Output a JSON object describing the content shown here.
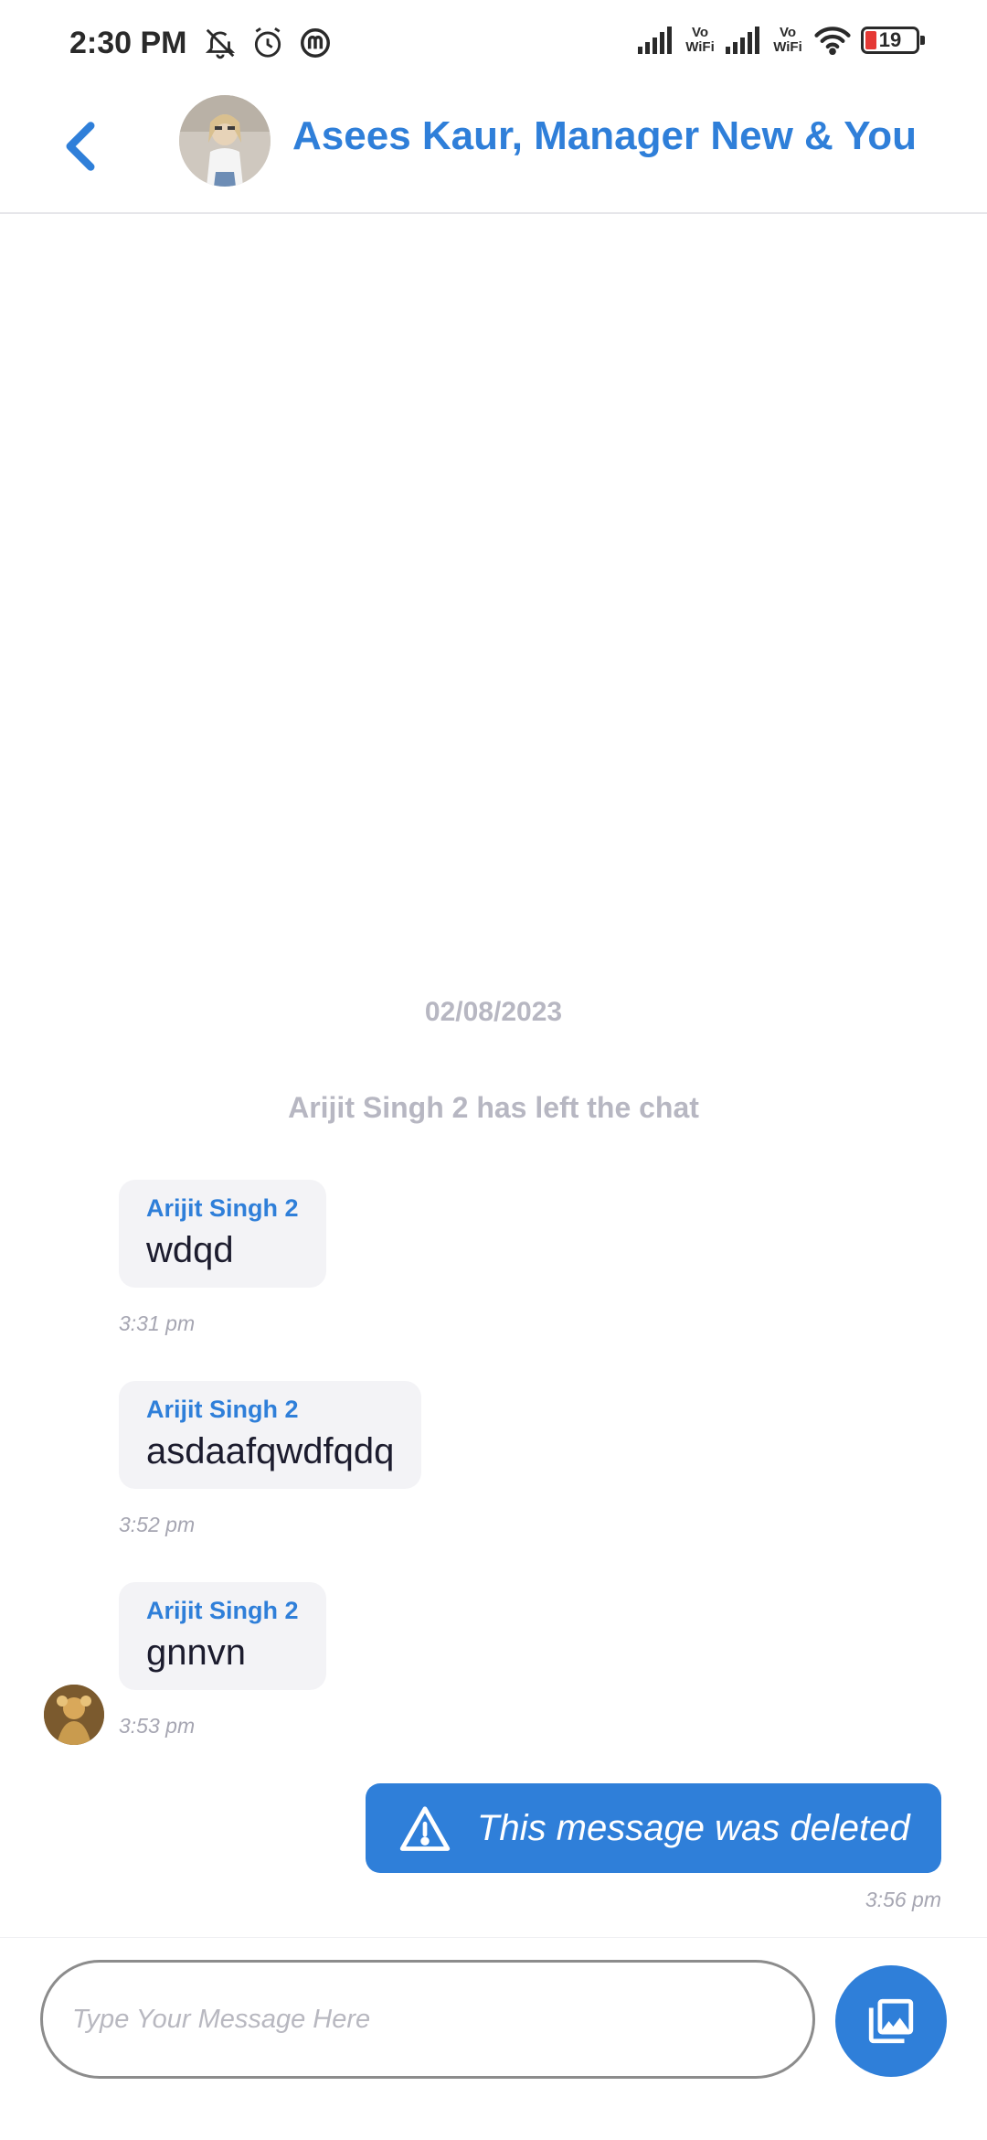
{
  "status_bar": {
    "time": "2:30 PM",
    "vowifi_1": "Vo WiFi",
    "vowifi_2": "Vo WiFi",
    "battery": "19"
  },
  "header": {
    "title": "Asees Kaur, Manager New & You"
  },
  "chat": {
    "date": "02/08/2023",
    "system_message": "Arijit Singh 2 has left the chat",
    "messages": [
      {
        "sender": "Arijit Singh 2",
        "text": "wdqd",
        "time": "3:31 pm"
      },
      {
        "sender": "Arijit Singh 2",
        "text": "asdaafqwdfqdq",
        "time": "3:52 pm"
      },
      {
        "sender": "Arijit Singh 2",
        "text": "gnnvn",
        "time": "3:53 pm"
      }
    ],
    "own_message": {
      "text": "This message was deleted",
      "time": "3:56 pm"
    }
  },
  "composer": {
    "placeholder": "Type Your Message Here",
    "value": ""
  },
  "colors": {
    "accent": "#2f7fd9",
    "bubble_bg": "#f3f3f6",
    "muted": "#b7b7c2"
  },
  "icons": {
    "back": "chevron-left-icon",
    "deleted": "warning-icon",
    "gallery": "gallery-icon"
  }
}
